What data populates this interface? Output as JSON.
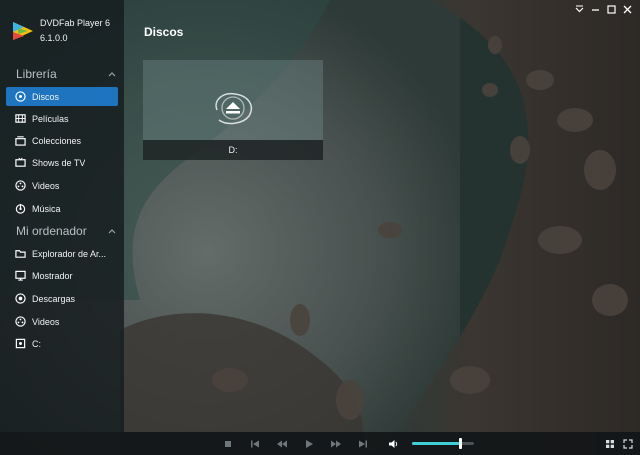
{
  "app": {
    "name": "DVDFab Player 6",
    "version": "6.1.0.0"
  },
  "sidebar": {
    "library": {
      "title": "Librería",
      "items": [
        {
          "label": "Discos",
          "icon": "disc-icon",
          "active": true
        },
        {
          "label": "Películas",
          "icon": "film-icon",
          "active": false
        },
        {
          "label": "Colecciones",
          "icon": "collection-icon",
          "active": false
        },
        {
          "label": "Shows de TV",
          "icon": "tv-icon",
          "active": false
        },
        {
          "label": "Videos",
          "icon": "video-icon",
          "active": false
        },
        {
          "label": "Música",
          "icon": "music-icon",
          "active": false
        }
      ]
    },
    "computer": {
      "title": "Mi ordenador",
      "items": [
        {
          "label": "Explorador de Ar...",
          "icon": "folder-icon"
        },
        {
          "label": "Mostrador",
          "icon": "desktop-icon"
        },
        {
          "label": "Descargas",
          "icon": "download-icon"
        },
        {
          "label": "Videos",
          "icon": "video-icon"
        },
        {
          "label": "C:",
          "icon": "drive-icon"
        }
      ]
    }
  },
  "main": {
    "title": "Discos",
    "discs": [
      {
        "label": "D:",
        "icon": "eject-icon"
      }
    ]
  },
  "player": {
    "volume_percent": 78,
    "accent_color": "#3fd0d8"
  },
  "colors": {
    "active_item": "#1e74bf"
  }
}
